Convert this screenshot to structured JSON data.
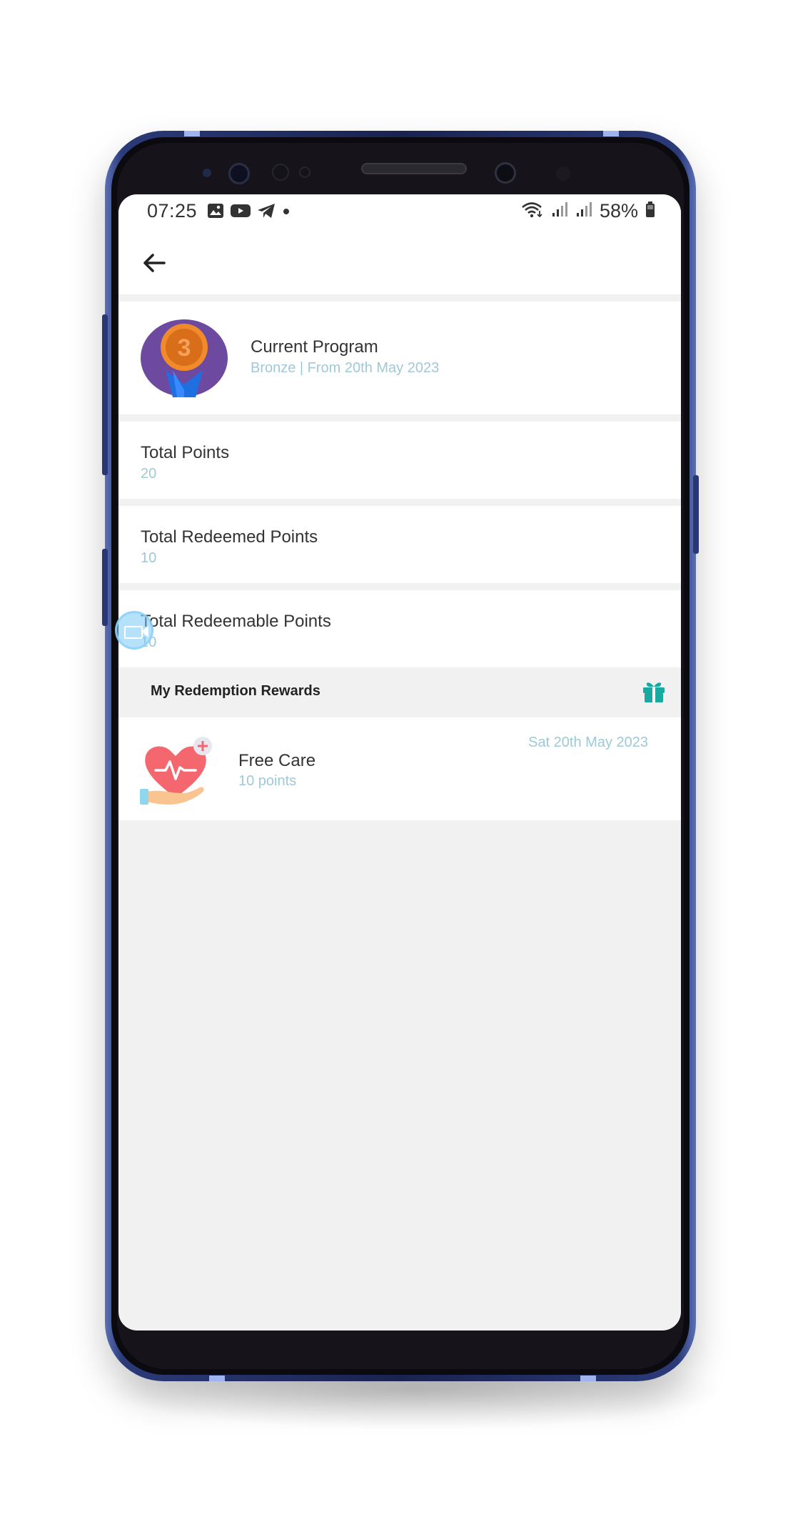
{
  "status_bar": {
    "time": "07:25",
    "battery": "58%",
    "left_icons": [
      "image-icon",
      "youtube-icon",
      "telegram-icon",
      "dot-icon"
    ],
    "right_icons": [
      "wifi-icon",
      "signal-icon",
      "signal-icon",
      "battery-icon"
    ]
  },
  "header": {
    "back_icon": "arrow-left-icon"
  },
  "program": {
    "title": "Current Program",
    "subtitle": "Bronze | From 20th May 2023",
    "medal_number": "3",
    "medal_icon": "bronze-medal-icon"
  },
  "stats": [
    {
      "label": "Total Points",
      "value": "20"
    },
    {
      "label": "Total Redeemed Points",
      "value": "10"
    },
    {
      "label": "Total Redeemable Points",
      "value": "10"
    }
  ],
  "rewards": {
    "title": "My Redemption Rewards",
    "icon": "gift-icon",
    "items": [
      {
        "name": "Free Care",
        "points": "10 points",
        "date": "Sat 20th May 2023",
        "icon": "heart-care-icon"
      }
    ]
  },
  "colors": {
    "primary_text": "#333333",
    "secondary_text": "#9fc9d6",
    "section_background": "#f1f1f1",
    "accent": "#1aa9a0",
    "frame": "#1a2250"
  }
}
